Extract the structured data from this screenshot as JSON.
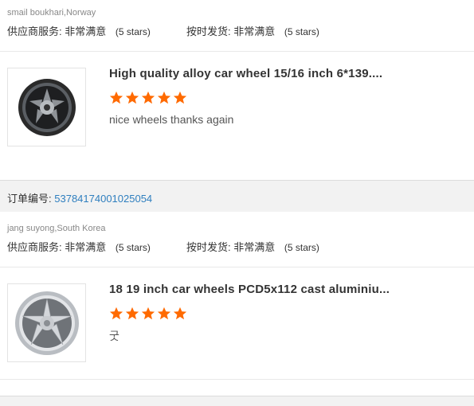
{
  "reviews": [
    {
      "buyer": "smail boukhari,Norway",
      "supplier_service_label": "供应商服务:",
      "supplier_service_value": "非常满意",
      "supplier_service_stars": "(5 stars)",
      "shipping_label": "按时发货:",
      "shipping_value": "非常满意",
      "shipping_stars": "(5 stars)",
      "product_title": "High quality alloy car wheel 15/16 inch 6*139....",
      "rating": 5,
      "comment": "nice wheels thanks again",
      "thumbnail_icon": "alloy-wheel-dark-icon"
    },
    {
      "order_label": "订单编号:",
      "order_number": "53784174001025054",
      "buyer": "jang suyong,South Korea",
      "supplier_service_label": "供应商服务:",
      "supplier_service_value": "非常满意",
      "supplier_service_stars": "(5 stars)",
      "shipping_label": "按时发货:",
      "shipping_value": "非常满意",
      "shipping_stars": "(5 stars)",
      "product_title": "18 19 inch car wheels PCD5x112 cast aluminiu...",
      "rating": 5,
      "comment": "굿",
      "thumbnail_icon": "alloy-wheel-silver-icon"
    }
  ],
  "colors": {
    "star": "#ff6a00",
    "order_number": "#2f7fbf",
    "bar_background": "#f2f2f2"
  }
}
